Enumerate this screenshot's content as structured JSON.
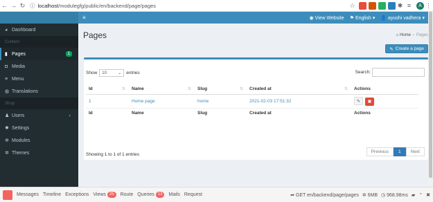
{
  "browser": {
    "url_host": "localhost",
    "url_path": "/modulegfg/public/en/backend/page/pages"
  },
  "topnav": {
    "view_website": "View Website",
    "language": "English",
    "user": "ayushi vadhera"
  },
  "sidebar": {
    "items": [
      {
        "label": "Dashboard",
        "icon": "dashboard-icon"
      },
      {
        "header": "Content"
      },
      {
        "label": "Pages",
        "icon": "file-icon",
        "badge": "1",
        "active": true
      },
      {
        "label": "Media",
        "icon": "camera-icon"
      },
      {
        "label": "Menu",
        "icon": "bars-icon"
      },
      {
        "label": "Translations",
        "icon": "globe-icon"
      },
      {
        "header": "Shop"
      },
      {
        "label": "Users",
        "icon": "user-icon"
      },
      {
        "label": "Settings",
        "icon": "gear-icon"
      },
      {
        "label": "Modules",
        "icon": "cogs-icon"
      },
      {
        "label": "Themes",
        "icon": "cogs-icon"
      }
    ]
  },
  "page": {
    "title": "Pages",
    "breadcrumb_home": "Home",
    "breadcrumb_current": "Pages",
    "create_button": "Create a page"
  },
  "table": {
    "show_label": "Show",
    "page_size": "10",
    "entries_label": "entries",
    "search_label": "Search:",
    "columns": [
      "Id",
      "Name",
      "Slug",
      "Created at",
      "Actions"
    ],
    "rows": [
      {
        "id": "1",
        "name": "Home page",
        "slug": "home",
        "created_at": "2021-02-03 17:51:32"
      }
    ],
    "info": "Showing 1 to 1 of 1 entries",
    "pager": {
      "previous": "Previous",
      "page": "1",
      "next": "Next"
    }
  },
  "debugbar": {
    "tabs": [
      {
        "label": "Messages"
      },
      {
        "label": "Timeline"
      },
      {
        "label": "Exceptions"
      },
      {
        "label": "Views",
        "badge": "25"
      },
      {
        "label": "Route"
      },
      {
        "label": "Queries",
        "badge": "13"
      },
      {
        "label": "Mails"
      },
      {
        "label": "Request"
      }
    ],
    "route": "GET en/backend/page/pages",
    "memory": "6MB",
    "time": "968.98ms"
  },
  "colors": {
    "sidebar_bg": "#222d32",
    "topnav_bg": "#3c8dbc",
    "badge_green": "#00a65a",
    "delete_red": "#dd4b39"
  }
}
